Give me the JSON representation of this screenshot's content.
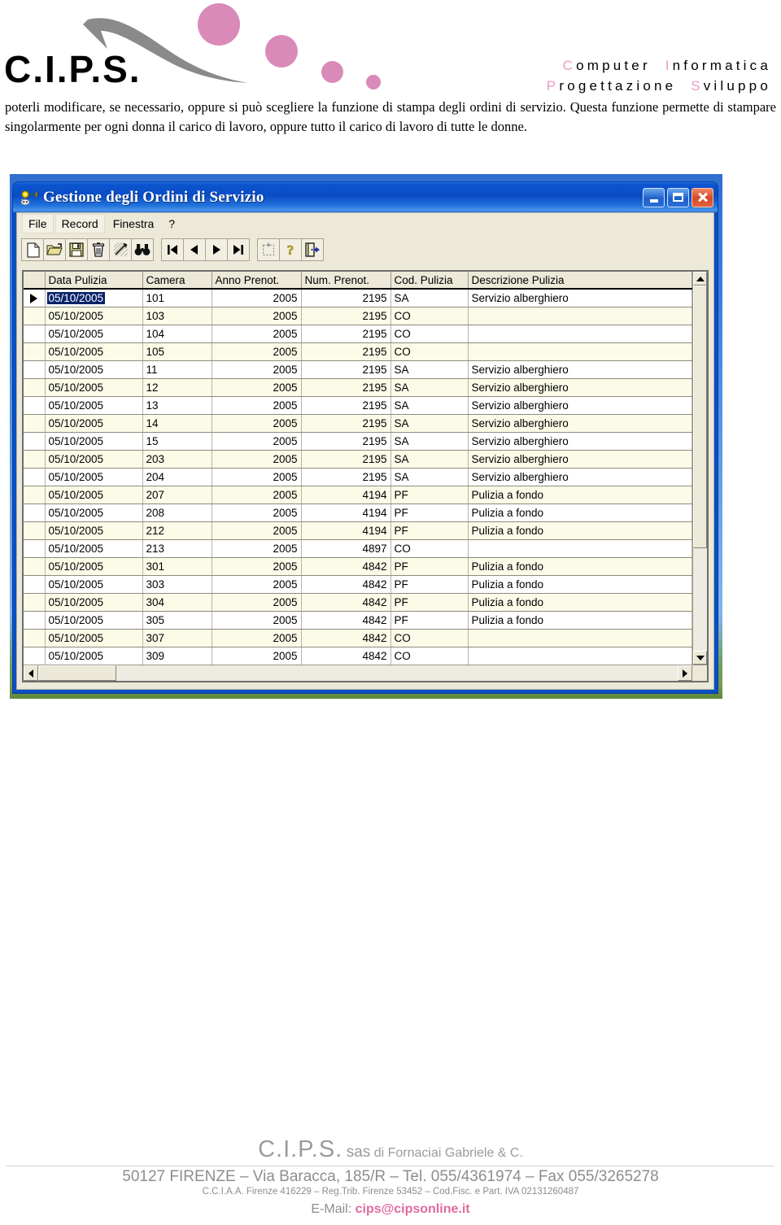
{
  "letterhead": {
    "logo_text": "C.I.P.S.",
    "brand_line1_cap": "C",
    "brand_line1_rest": "omputer",
    "brand_line1_cap2": "I",
    "brand_line1_rest2": "nformatica",
    "brand_line2_cap": "P",
    "brand_line2_rest": "rogettazione",
    "brand_line2_cap2": "S",
    "brand_line2_rest2": "viluppo"
  },
  "body": {
    "paragraph": "poterli modificare, se necessario, oppure si può scegliere la funzione di stampa degli ordini di servizio. Questa funzione permette di stampare singolarmente per ogni donna il carico di lavoro, oppure tutto il carico di lavoro di tutte le donne."
  },
  "window": {
    "title": "Gestione degli Ordini di Servizio",
    "icon": "key-plug-icon",
    "buttons": {
      "minimize": "minimize-button",
      "maximize": "maximize-button",
      "close": "close-button"
    },
    "menu": [
      {
        "label": "File",
        "raised": true
      },
      {
        "label": "Record",
        "raised": true
      },
      {
        "label": "Finestra",
        "raised": false
      },
      {
        "label": "?",
        "raised": false
      }
    ],
    "toolbar": [
      {
        "name": "new-record-icon",
        "group": 1
      },
      {
        "name": "open-folder-icon",
        "group": 1
      },
      {
        "name": "save-disk-icon",
        "group": 1
      },
      {
        "name": "delete-trash-icon",
        "group": 1
      },
      {
        "name": "filter-remove-icon",
        "group": 1
      },
      {
        "name": "find-binoculars-icon",
        "group": 1
      },
      {
        "name": "first-record-icon",
        "group": 2
      },
      {
        "name": "previous-record-icon",
        "group": 2
      },
      {
        "name": "next-record-icon",
        "group": 2
      },
      {
        "name": "last-record-icon",
        "group": 2
      },
      {
        "name": "select-area-icon",
        "group": 3
      },
      {
        "name": "help-question-icon",
        "group": 3
      },
      {
        "name": "exit-door-icon",
        "group": 3
      }
    ]
  },
  "grid": {
    "columns": [
      "Data Pulizia",
      "Camera",
      "Anno Prenot.",
      "Num. Prenot.",
      "Cod. Pulizia",
      "Descrizione Pulizia"
    ],
    "selected_row_index": 0,
    "selected_cell_value": "05/10/2005",
    "rows": [
      {
        "data_pulizia": "05/10/2005",
        "camera": "101",
        "anno_prenot": "2005",
        "num_prenot": "2195",
        "cod_pulizia": "SA",
        "descrizione": "Servizio alberghiero"
      },
      {
        "data_pulizia": "05/10/2005",
        "camera": "103",
        "anno_prenot": "2005",
        "num_prenot": "2195",
        "cod_pulizia": "CO",
        "descrizione": ""
      },
      {
        "data_pulizia": "05/10/2005",
        "camera": "104",
        "anno_prenot": "2005",
        "num_prenot": "2195",
        "cod_pulizia": "CO",
        "descrizione": ""
      },
      {
        "data_pulizia": "05/10/2005",
        "camera": "105",
        "anno_prenot": "2005",
        "num_prenot": "2195",
        "cod_pulizia": "CO",
        "descrizione": ""
      },
      {
        "data_pulizia": "05/10/2005",
        "camera": "11",
        "anno_prenot": "2005",
        "num_prenot": "2195",
        "cod_pulizia": "SA",
        "descrizione": "Servizio alberghiero"
      },
      {
        "data_pulizia": "05/10/2005",
        "camera": "12",
        "anno_prenot": "2005",
        "num_prenot": "2195",
        "cod_pulizia": "SA",
        "descrizione": "Servizio alberghiero"
      },
      {
        "data_pulizia": "05/10/2005",
        "camera": "13",
        "anno_prenot": "2005",
        "num_prenot": "2195",
        "cod_pulizia": "SA",
        "descrizione": "Servizio alberghiero"
      },
      {
        "data_pulizia": "05/10/2005",
        "camera": "14",
        "anno_prenot": "2005",
        "num_prenot": "2195",
        "cod_pulizia": "SA",
        "descrizione": "Servizio alberghiero"
      },
      {
        "data_pulizia": "05/10/2005",
        "camera": "15",
        "anno_prenot": "2005",
        "num_prenot": "2195",
        "cod_pulizia": "SA",
        "descrizione": "Servizio alberghiero"
      },
      {
        "data_pulizia": "05/10/2005",
        "camera": "203",
        "anno_prenot": "2005",
        "num_prenot": "2195",
        "cod_pulizia": "SA",
        "descrizione": "Servizio alberghiero"
      },
      {
        "data_pulizia": "05/10/2005",
        "camera": "204",
        "anno_prenot": "2005",
        "num_prenot": "2195",
        "cod_pulizia": "SA",
        "descrizione": "Servizio alberghiero"
      },
      {
        "data_pulizia": "05/10/2005",
        "camera": "207",
        "anno_prenot": "2005",
        "num_prenot": "4194",
        "cod_pulizia": "PF",
        "descrizione": "Pulizia a fondo"
      },
      {
        "data_pulizia": "05/10/2005",
        "camera": "208",
        "anno_prenot": "2005",
        "num_prenot": "4194",
        "cod_pulizia": "PF",
        "descrizione": "Pulizia a fondo"
      },
      {
        "data_pulizia": "05/10/2005",
        "camera": "212",
        "anno_prenot": "2005",
        "num_prenot": "4194",
        "cod_pulizia": "PF",
        "descrizione": "Pulizia a fondo"
      },
      {
        "data_pulizia": "05/10/2005",
        "camera": "213",
        "anno_prenot": "2005",
        "num_prenot": "4897",
        "cod_pulizia": "CO",
        "descrizione": ""
      },
      {
        "data_pulizia": "05/10/2005",
        "camera": "301",
        "anno_prenot": "2005",
        "num_prenot": "4842",
        "cod_pulizia": "PF",
        "descrizione": "Pulizia a fondo"
      },
      {
        "data_pulizia": "05/10/2005",
        "camera": "303",
        "anno_prenot": "2005",
        "num_prenot": "4842",
        "cod_pulizia": "PF",
        "descrizione": "Pulizia a fondo"
      },
      {
        "data_pulizia": "05/10/2005",
        "camera": "304",
        "anno_prenot": "2005",
        "num_prenot": "4842",
        "cod_pulizia": "PF",
        "descrizione": "Pulizia a fondo"
      },
      {
        "data_pulizia": "05/10/2005",
        "camera": "305",
        "anno_prenot": "2005",
        "num_prenot": "4842",
        "cod_pulizia": "PF",
        "descrizione": "Pulizia a fondo"
      },
      {
        "data_pulizia": "05/10/2005",
        "camera": "307",
        "anno_prenot": "2005",
        "num_prenot": "4842",
        "cod_pulizia": "CO",
        "descrizione": ""
      },
      {
        "data_pulizia": "05/10/2005",
        "camera": "309",
        "anno_prenot": "2005",
        "num_prenot": "4842",
        "cod_pulizia": "CO",
        "descrizione": ""
      }
    ]
  },
  "footer": {
    "company": "C.I.P.S.",
    "sas": "sas",
    "di": "di Fornaciai Gabriele & C.",
    "address": "50127 FIRENZE – Via Baracca, 185/R – Tel. 055/4361974 – Fax 055/3265278",
    "legal": "C.C.I.A.A. Firenze 416229 – Reg.Trib. Firenze 53452 – Cod.Fisc. e Part. IVA 02131260487",
    "mail_label": "E-Mail:",
    "mail": "cips@cipsonline.it"
  },
  "colors": {
    "pink": "#d98ab8",
    "brand_pink": "#e89ec4",
    "title_blue": "#0a4cc6",
    "selection_blue": "#0a246a",
    "row_alt": "#fbfbe8"
  }
}
